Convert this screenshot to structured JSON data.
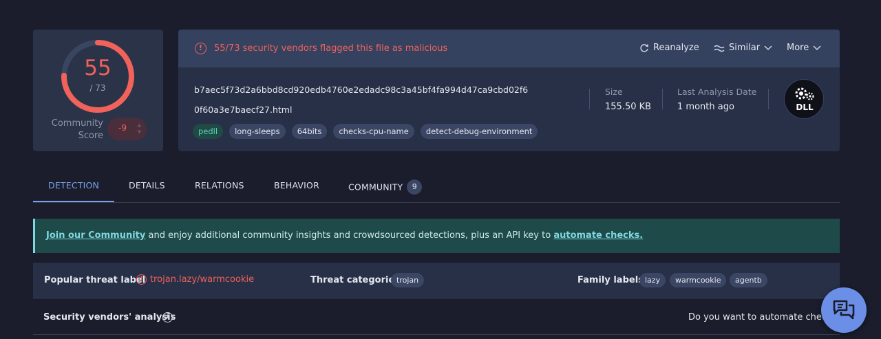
{
  "score": {
    "detections": "55",
    "total": "/ 73",
    "fraction": 0.753,
    "community_label_1": "Community",
    "community_label_2": "Score",
    "community_value": "-9"
  },
  "alert": {
    "text": "55/73 security vendors flagged this file as malicious"
  },
  "header_buttons": {
    "reanalyze": "Reanalyze",
    "similar": "Similar",
    "more": "More"
  },
  "file": {
    "hash": "b7aec5f73d2a6bbd8cd920edb4760e2edadc98c3a45bf4fa994d47ca9cbd02f6",
    "name": "0f60a3e7baecf27.html",
    "tags": [
      "pedll",
      "long-sleeps",
      "64bits",
      "checks-cpu-name",
      "detect-debug-environment"
    ],
    "size_label": "Size",
    "size_value": "155.50 KB",
    "last_analysis_label": "Last Analysis Date",
    "last_analysis_value": "1 month ago",
    "type_badge": "DLL"
  },
  "tabs": [
    {
      "label": "DETECTION"
    },
    {
      "label": "DETAILS"
    },
    {
      "label": "RELATIONS"
    },
    {
      "label": "BEHAVIOR"
    },
    {
      "label": "COMMUNITY",
      "count": "9"
    }
  ],
  "banner": {
    "link1": "Join our Community",
    "middle": " and enjoy additional community insights and crowdsourced detections, plus an API key to ",
    "link2": "automate checks."
  },
  "labels": {
    "popular_label": "Popular threat label",
    "popular_value": "trojan.lazy/warmcookie",
    "categories_label": "Threat categories",
    "categories": [
      "trojan"
    ],
    "family_label": "Family labels",
    "families": [
      "lazy",
      "warmcookie",
      "agentb"
    ]
  },
  "vendors": {
    "title": "Security vendors' analysis",
    "automate_prompt": "Do you want to automate checks?"
  },
  "colors": {
    "malicious": "#f0625a",
    "accent": "#7aa2e8",
    "background": "#1b1c2c"
  }
}
